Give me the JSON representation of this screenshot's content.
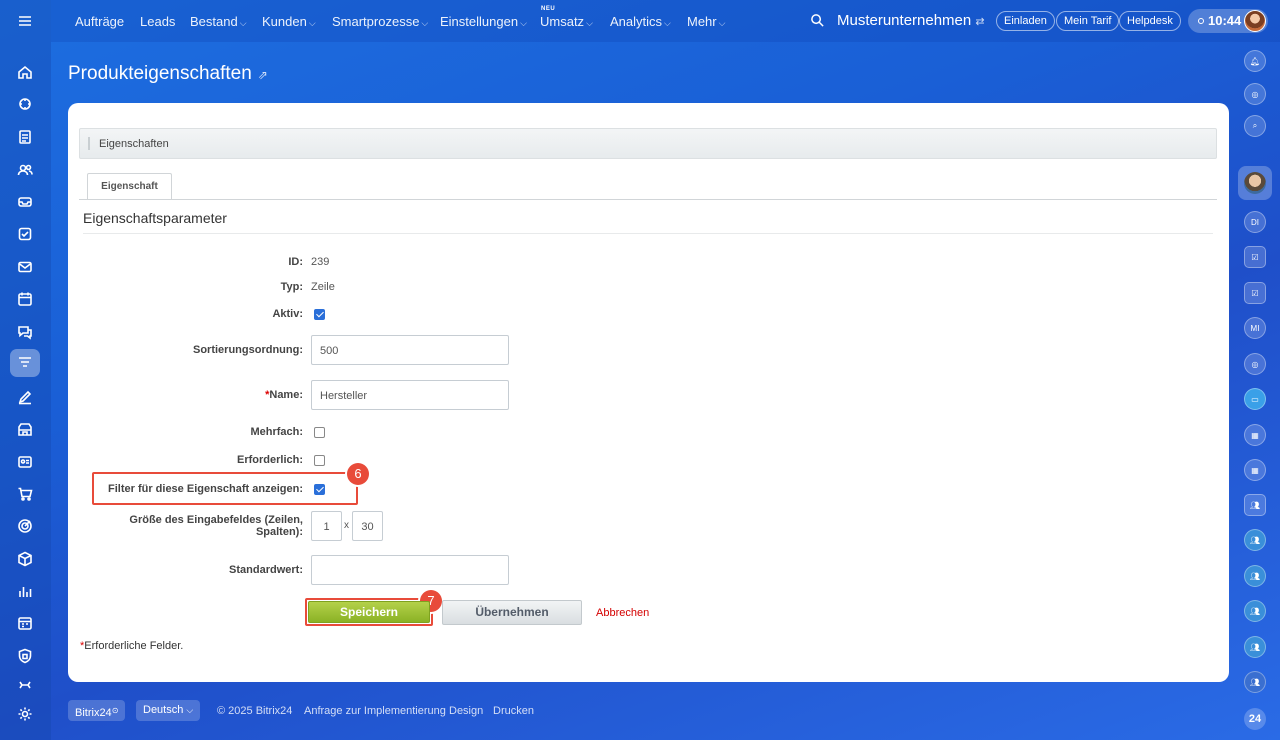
{
  "topnav": {
    "items": [
      {
        "label": "Aufträge",
        "chevron": false
      },
      {
        "label": "Leads",
        "chevron": false
      },
      {
        "label": "Bestand",
        "chevron": true
      },
      {
        "label": "Kunden",
        "chevron": true
      },
      {
        "label": "Smartprozesse",
        "chevron": true
      },
      {
        "label": "Einstellungen",
        "chevron": true
      },
      {
        "label": "Umsatz",
        "chevron": true
      },
      {
        "label": "Analytics",
        "chevron": true
      },
      {
        "label": "Mehr",
        "chevron": true
      }
    ],
    "new_badge": "NEU",
    "company": "Musterunternehmen",
    "invite": "Einladen",
    "tariff": "Mein Tarif",
    "helpdesk": "Helpdesk",
    "time": "10:44"
  },
  "page": {
    "title": "Produkteigenschaften"
  },
  "form": {
    "section": "Eigenschaften",
    "tab": "Eigenschaft",
    "params_title": "Eigenschaftsparameter",
    "id_label": "ID:",
    "id_value": "239",
    "type_label": "Typ:",
    "type_value": "Zeile",
    "active_label": "Aktiv:",
    "active": true,
    "sort_label": "Sortierungsordnung:",
    "sort_value": "500",
    "name_req": "*",
    "name_label": "Name:",
    "name_value": "Hersteller",
    "multiple_label": "Mehrfach:",
    "multiple": false,
    "required_label": "Erforderlich:",
    "required": false,
    "filter_label": "Filter für diese Eigenschaft anzeigen:",
    "filter": true,
    "size_label_1": "Größe des Eingabefeldes (Zeilen,",
    "size_label_2": "Spalten):",
    "rows": "1",
    "size_sep": "x",
    "cols": "30",
    "default_label": "Standardwert:",
    "default_value": "",
    "save": "Speichern",
    "apply": "Übernehmen",
    "cancel": "Abbrechen",
    "required_note_star": "*",
    "required_note": "Erforderliche Felder.",
    "marker_filter": "6",
    "marker_save": "7"
  },
  "footer": {
    "brand": "Bitrix24",
    "language": "Deutsch",
    "copyright": "© 2025 Bitrix24",
    "links": [
      "Anfrage zur Implementierung",
      "Design",
      "Drucken"
    ]
  },
  "rightbar": {
    "bottom_logo": "24"
  }
}
